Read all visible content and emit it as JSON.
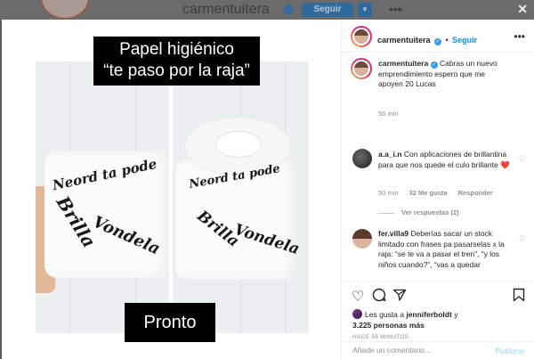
{
  "background": {
    "username": "carmentuitera",
    "follow_label": "Seguir",
    "close_icon": "close-icon"
  },
  "media": {
    "caption_top": "Papel higiénico\n“te paso por la raja”",
    "caption_bottom": "Pronto",
    "roll_writing": [
      "Neord ta pode",
      "Brilla",
      "Vondela",
      "Brilla",
      "Vondela",
      "Neord ta pode"
    ]
  },
  "post": {
    "username": "carmentuitera",
    "follow_label": "Seguir",
    "dot": "•",
    "caption_text": "Cabras un nuevo emprendimiento espero que me apoyen 20 Lucas",
    "caption_time": "56 min",
    "comments": [
      {
        "username": "a.a_i.n",
        "text": "Con aplicaciones de brillantina para que nos quede el culo brillante ❤️",
        "time": "50 min",
        "likes": "32 Me gusta",
        "reply": "Responder",
        "view_replies": "Ver respuestas (2)"
      },
      {
        "username": "fer.villa9",
        "text": "Deberías sacar un stock limitado con frases pa pasarselas x la raja: “se te va a pasar el tren”, “y los niños cuando?”, “vas a quedar"
      }
    ],
    "likes_prefix": "Les gusta a",
    "likes_user": "jenniferboldt",
    "likes_joiner": "y",
    "likes_count": "3.225 personas",
    "likes_suffix": "más",
    "time_ago": "HACE 56 MINUTOS",
    "add_comment_placeholder": "Añade un comentario...",
    "post_label": "Publicar"
  },
  "colors": {
    "accent": "#0095f6",
    "verified": "#3897f0",
    "post_disabled": "#b2dffc",
    "heart_red": "#ed4956"
  }
}
